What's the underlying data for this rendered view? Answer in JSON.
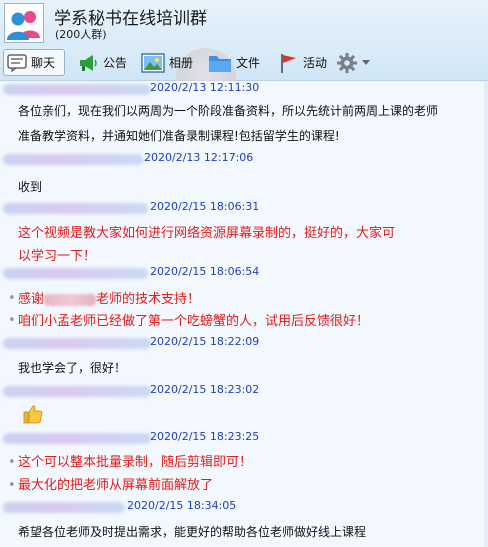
{
  "header": {
    "title": "学系秘书在线培训群",
    "member_count": "(200人群)"
  },
  "toolbar": {
    "tabs": [
      {
        "label": "聊天",
        "icon": "chat-bubble-icon",
        "active": true
      },
      {
        "label": "公告",
        "icon": "megaphone-icon",
        "active": false
      },
      {
        "label": "相册",
        "icon": "photo-album-icon",
        "active": false
      },
      {
        "label": "文件",
        "icon": "folder-icon",
        "active": false
      },
      {
        "label": "活动",
        "icon": "flag-icon",
        "active": false
      }
    ],
    "settings_icon": "gear-icon",
    "settings_dropdown_icon": "caret-down-icon"
  },
  "messages": [
    {
      "time": "2020/2/13 12:11:30",
      "color": "#111111",
      "lines": [
        "各位亲们，现在我们以两周为一个阶段准备资料，所以先统计前两周上课的老师",
        "准备教学资料，并通知她们准备录制课程!包括留学生的课程!"
      ]
    },
    {
      "time": "2020/2/13 12:17:06",
      "color": "#111111",
      "lines": [
        "收到"
      ]
    },
    {
      "time": "2020/2/15 18:06:31",
      "color": "#e31b1b",
      "lines": [
        "这个视频是教大家如何进行网络资源屏幕录制的，挺好的，大家可",
        "以学习一下！"
      ]
    },
    {
      "time": "2020/2/15 18:06:54",
      "color": "#e31b1b",
      "lines": [
        "感谢",
        "老师的技术支持！",
        "咱们小孟老师已经做了第一个吃螃蟹的人，试用后反馈很好！"
      ]
    },
    {
      "time": "2020/2/15 18:22:09",
      "color": "#111111",
      "lines": [
        "我也学会了，很好！"
      ]
    },
    {
      "time": "2020/2/15 18:23:02",
      "color": "#111111",
      "emoji": "thumbs-up-icon",
      "lines": []
    },
    {
      "time": "2020/2/15 18:23:25",
      "color": "#e31b1b",
      "lines": [
        "这个可以整本批量录制，随后剪辑即可！",
        "最大化的把老师从屏幕前面解放了"
      ]
    },
    {
      "time": "2020/2/15 18:34:05",
      "color": "#111111",
      "lines": [
        "希望各位老师及时提出需求，能更好的帮助各位老师做好线上课程"
      ]
    }
  ]
}
